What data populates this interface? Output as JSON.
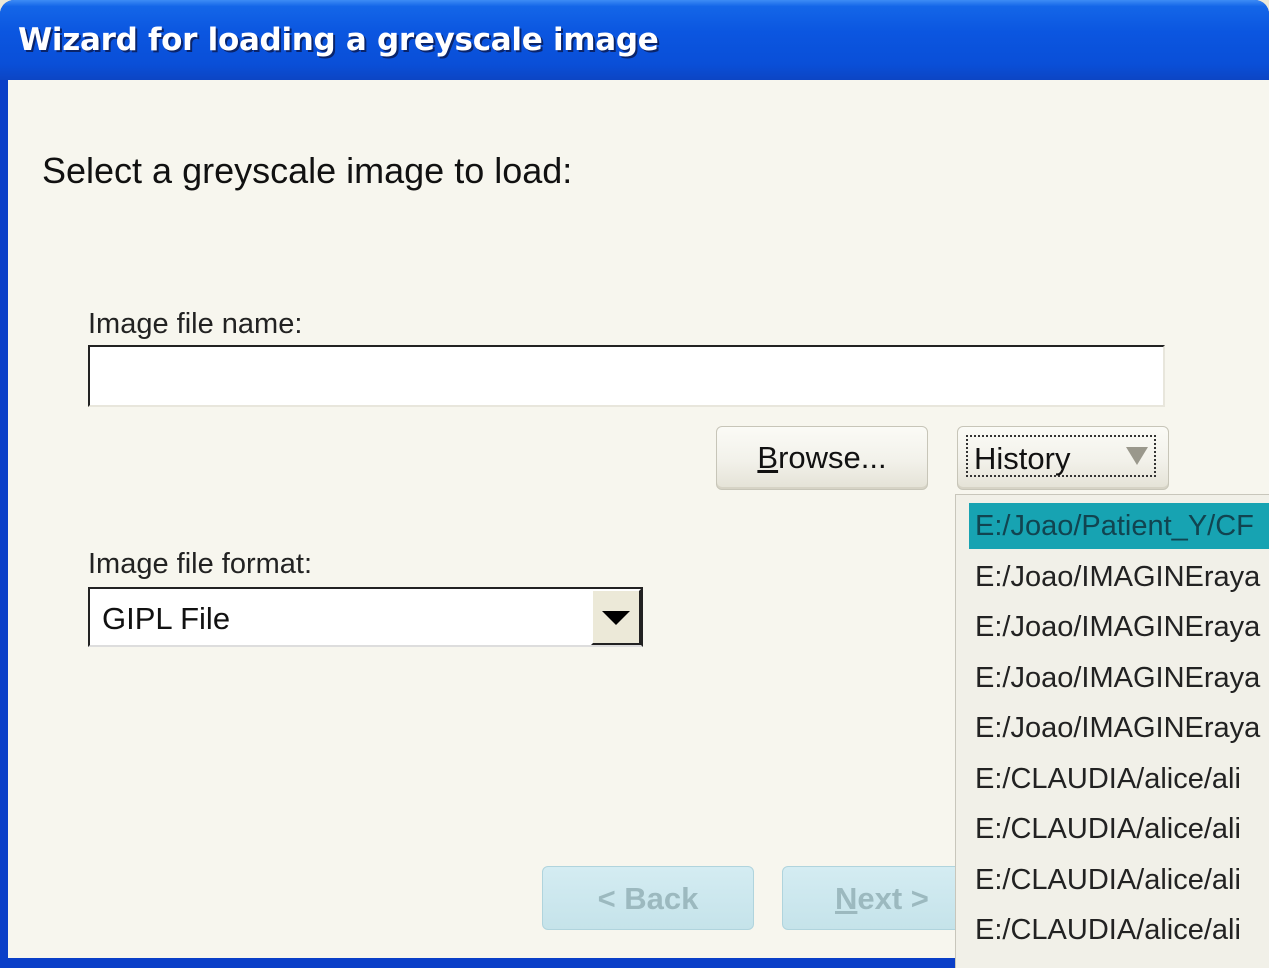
{
  "window": {
    "title": "Wizard for loading a greyscale image"
  },
  "heading": "Select a greyscale image to load:",
  "filename": {
    "label": "Image file name:",
    "value": "",
    "placeholder": ""
  },
  "buttons": {
    "browse": "Browse...",
    "history": "History",
    "back": "< Back",
    "next": "Next >"
  },
  "format": {
    "label": "Image file format:",
    "selected": "GIPL File"
  },
  "history_list": {
    "items": [
      {
        "label": "E:/Joao/Patient_Y/CF",
        "selected": true
      },
      {
        "label": "E:/Joao/IMAGINEraya",
        "selected": false
      },
      {
        "label": "E:/Joao/IMAGINEraya",
        "selected": false
      },
      {
        "label": "E:/Joao/IMAGINEraya",
        "selected": false
      },
      {
        "label": "E:/Joao/IMAGINEraya",
        "selected": false
      },
      {
        "label": "E:/CLAUDIA/alice/ali",
        "selected": false
      },
      {
        "label": "E:/CLAUDIA/alice/ali",
        "selected": false
      },
      {
        "label": "E:/CLAUDIA/alice/ali",
        "selected": false
      },
      {
        "label": "E:/CLAUDIA/alice/ali",
        "selected": false
      }
    ]
  },
  "colors": {
    "titlebar": "#0b56e0",
    "selection": "#17a3b2",
    "disabled_button": "#c5e3ea"
  }
}
